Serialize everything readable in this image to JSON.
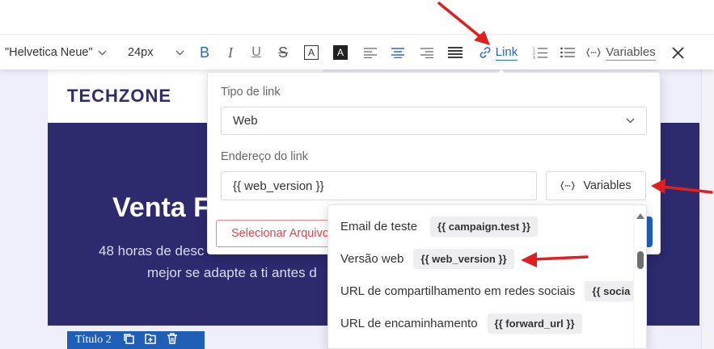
{
  "toolbar": {
    "font_family": "\"Helvetica Neue\"",
    "font_size": "24px",
    "bold": "B",
    "italic": "I",
    "underline": "U",
    "strike": "S",
    "text_color": "A",
    "bg_color": "A",
    "link_label": "Link",
    "variables_label": "Variables",
    "close_glyph": "✕",
    "chevron_glyph": "⌄"
  },
  "email": {
    "brand": "TECHZONE",
    "hero_title": "Venta F",
    "hero_text_line1": "48 horas de desc",
    "hero_text_line2": "mejor se adapte a ti antes d",
    "block_label": "Título 2"
  },
  "link_popover": {
    "type_label": "Tipo de link",
    "type_value": "Web",
    "address_label": "Endereço do link",
    "address_value": "{{ web_version }}",
    "variables_button": "Variables",
    "select_file_button": "Selecionar Arquivo"
  },
  "variables_menu": {
    "items": [
      {
        "label": "Email de teste",
        "tag": "{{ campaign.test }}"
      },
      {
        "label": "Versão web",
        "tag": "{{ web_version }}"
      },
      {
        "label": "URL de compartilhamento em redes sociais",
        "tag": "{{ socia"
      },
      {
        "label": "URL de encaminhamento",
        "tag": "{{ forward_url }}"
      }
    ]
  },
  "colors": {
    "accent_blue": "#2b66c9",
    "hero_bg": "#2d2a6e",
    "annotation_red": "#e02020",
    "danger_red": "#d9474f"
  }
}
